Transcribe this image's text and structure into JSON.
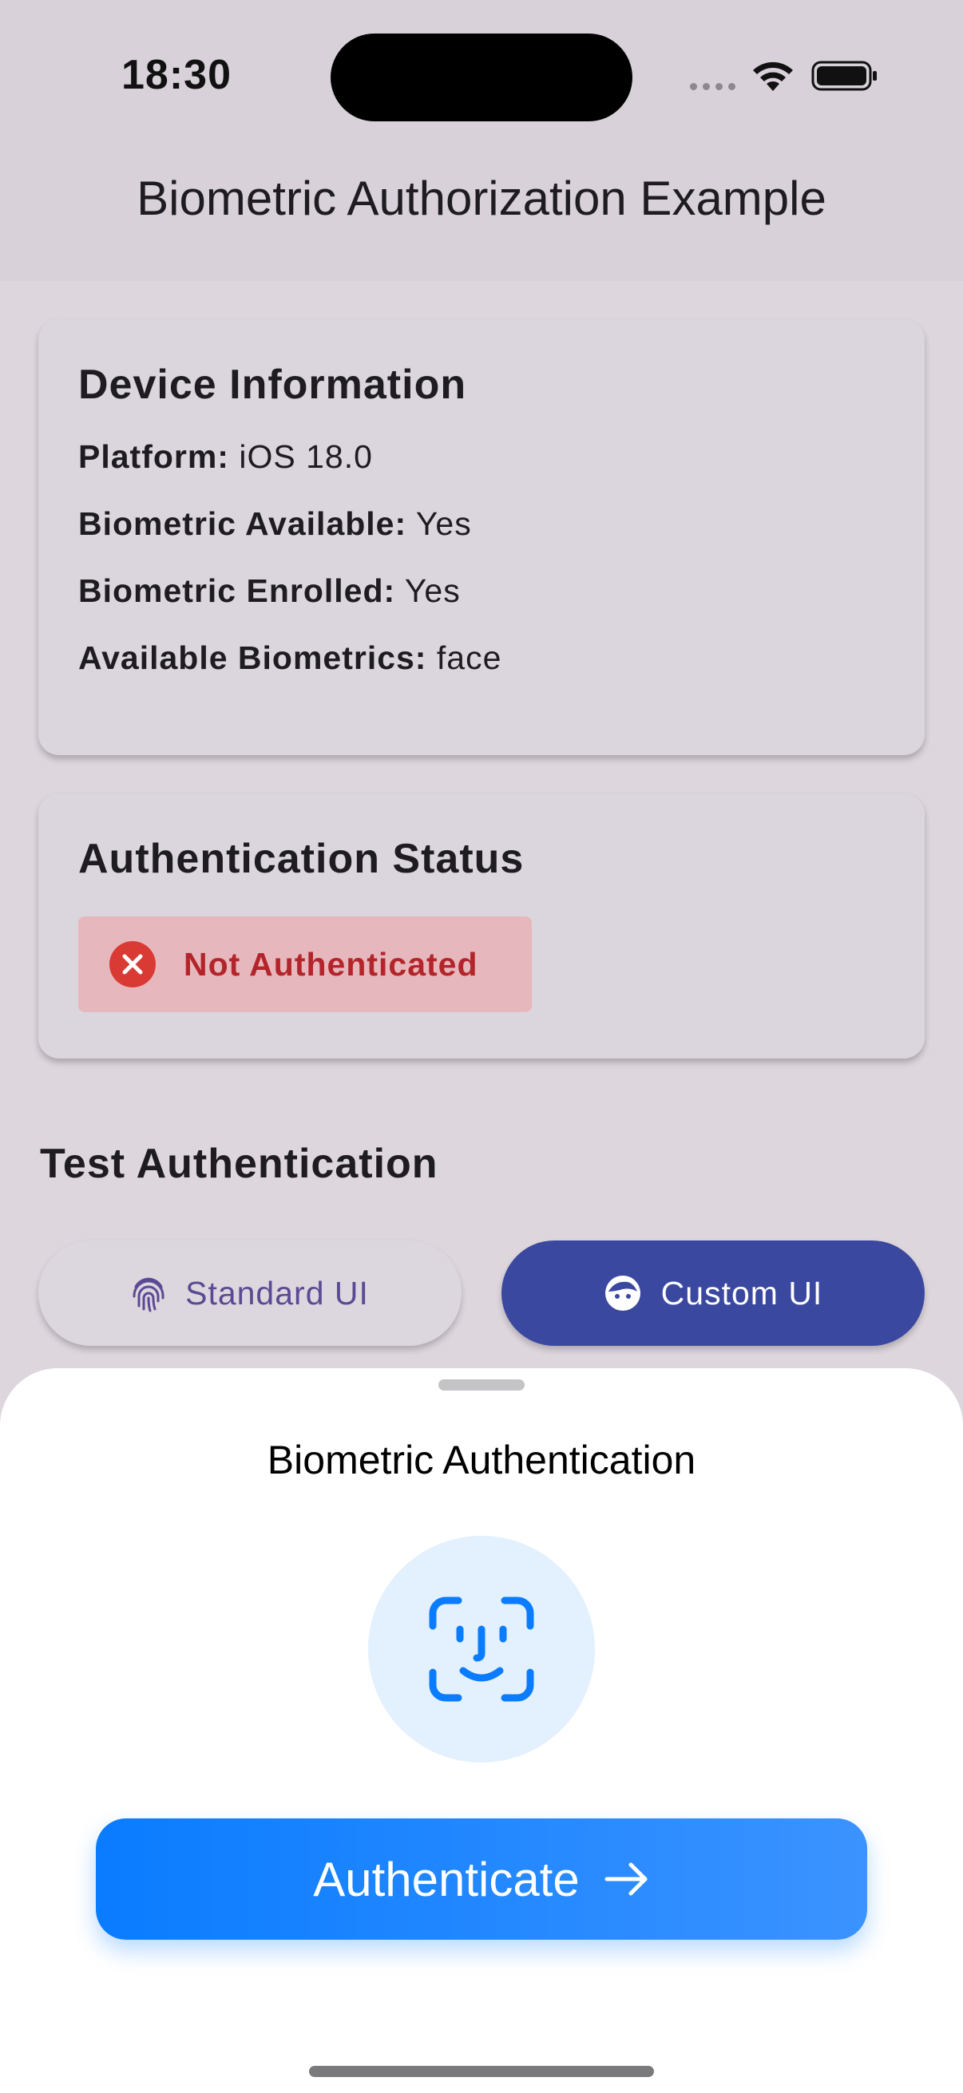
{
  "status_bar": {
    "time": "18:30"
  },
  "app_bar": {
    "title": "Biometric Authorization Example"
  },
  "device_info": {
    "title": "Device Information",
    "rows": [
      {
        "label": "Platform:",
        "value": "iOS 18.0"
      },
      {
        "label": "Biometric Available:",
        "value": "Yes"
      },
      {
        "label": "Biometric Enrolled:",
        "value": "Yes"
      },
      {
        "label": "Available Biometrics:",
        "value": "face"
      }
    ]
  },
  "auth_status": {
    "title": "Authentication Status",
    "status": "Not Authenticated",
    "status_color": "#b3252a"
  },
  "test_section": {
    "title": "Test Authentication",
    "standard_label": "Standard UI",
    "custom_label": "Custom UI"
  },
  "sheet": {
    "title": "Biometric Authentication",
    "button_label": "Authenticate",
    "accent": "#0a7cff"
  },
  "icons": {
    "status_error": "x-circle-icon",
    "standard": "fingerprint-icon",
    "custom": "face-icon",
    "sheet": "face-id-icon",
    "button": "arrow-right-icon"
  }
}
